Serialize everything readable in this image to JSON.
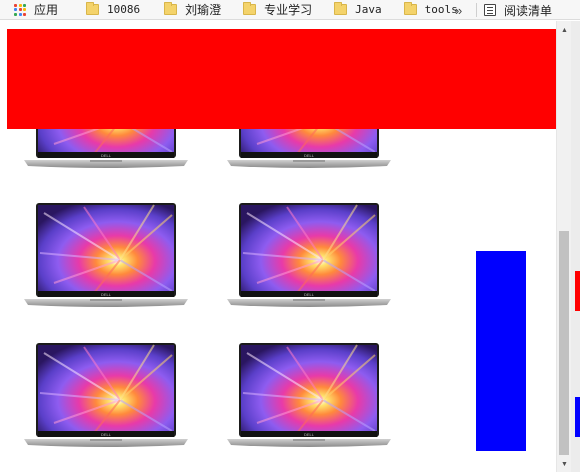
{
  "bookmarks": {
    "apps_label": "应用",
    "items": [
      "10086",
      "刘瑜澄",
      "专业学习",
      "Java",
      "tools"
    ],
    "overflow_label": "»",
    "reading_list_label": "阅读清单"
  },
  "colors": {
    "banner": "#ff0000",
    "sidebar_box": "#0000ff"
  },
  "page": {
    "product_image_alt": "Dell laptop",
    "laptop_count": 6,
    "logo_text": "DELL"
  }
}
